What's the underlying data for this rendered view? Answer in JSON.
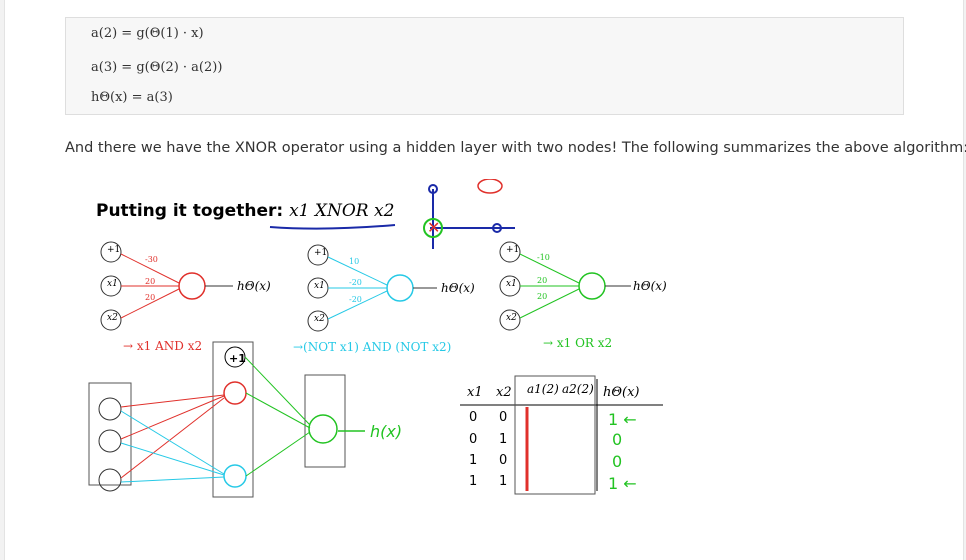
{
  "formulas": {
    "line1": "a(2) = g(Θ(1) · x)",
    "line2": "a(3) = g(Θ(2) · a(2))",
    "line3": "hΘ(x) = a(3)"
  },
  "paragraph": "And there we have the XNOR operator using a hidden layer with two nodes! The following summarizes the above algorithm:",
  "figure": {
    "title_prefix": "Putting it together:",
    "title_math": "x1 XNOR x2",
    "net1": {
      "bias": "+1",
      "x1": "x1",
      "x2": "x2",
      "weights": [
        "-30",
        "20",
        "20"
      ],
      "output": "hΘ(x)",
      "caption": "→ x1 AND x2"
    },
    "net2": {
      "bias": "+1",
      "x1": "x1",
      "x2": "x2",
      "weights": [
        "10",
        "-20",
        "-20"
      ],
      "output": "hΘ(x)",
      "caption": "→(NOT x1) AND (NOT x2)"
    },
    "net3": {
      "bias": "+1",
      "x1": "x1",
      "x2": "x2",
      "weights": [
        "-10",
        "20",
        "20"
      ],
      "output": "hΘ(x)",
      "caption": "→ x1 OR x2"
    },
    "table": {
      "headers": [
        "x1",
        "x2",
        "a1(2)",
        "a2(2)",
        "hΘ(x)"
      ],
      "rows": [
        [
          "0",
          "0"
        ],
        [
          "0",
          "1"
        ],
        [
          "1",
          "0"
        ],
        [
          "1",
          "1"
        ]
      ]
    },
    "colors": {
      "and": "#e0302b",
      "not": "#26c9e6",
      "or": "#22c322",
      "ink": "#1a2aa8"
    }
  }
}
